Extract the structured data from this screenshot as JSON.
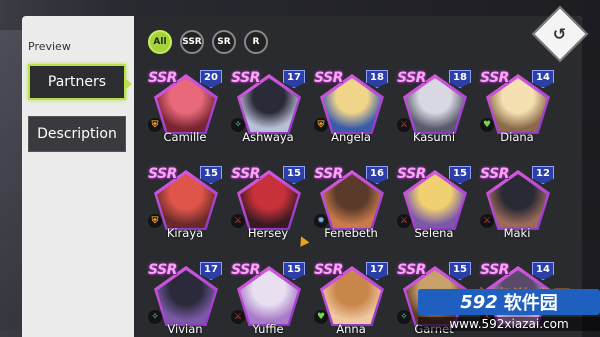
{
  "sidebar": {
    "preview_label": "Preview",
    "items": [
      {
        "label": "Partners",
        "active": true
      },
      {
        "label": "Description",
        "active": false
      }
    ]
  },
  "filters": [
    {
      "label": "All",
      "active": true
    },
    {
      "label": "SSR",
      "active": false
    },
    {
      "label": "SR",
      "active": false
    },
    {
      "label": "R",
      "active": false
    }
  ],
  "back_icon": "return-arrow-icon",
  "partners": [
    {
      "name": "Camille",
      "rarity": "SSR",
      "level": "20",
      "role": "shield",
      "role_color": "#e8a02a",
      "portrait": [
        "#e86a7a",
        "#7a2432"
      ]
    },
    {
      "name": "Ashwaya",
      "rarity": "SSR",
      "level": "17",
      "role": "wings",
      "role_color": "#7fd6a6",
      "portrait": [
        "#2a2a38",
        "#b9bfd6"
      ]
    },
    {
      "name": "Angela",
      "rarity": "SSR",
      "level": "18",
      "role": "shield",
      "role_color": "#e8a02a",
      "portrait": [
        "#f0d48a",
        "#3a5ca8"
      ]
    },
    {
      "name": "Kasumi",
      "rarity": "SSR",
      "level": "18",
      "role": "blade",
      "role_color": "#d63b3b",
      "portrait": [
        "#d8d8e2",
        "#5a5a6e"
      ]
    },
    {
      "name": "Diana",
      "rarity": "SSR",
      "level": "14",
      "role": "heart",
      "role_color": "#6fd84a",
      "portrait": [
        "#f4e0b0",
        "#8a6a4a"
      ]
    },
    {
      "name": "Kiraya",
      "rarity": "SSR",
      "level": "15",
      "role": "shield",
      "role_color": "#e8a02a",
      "portrait": [
        "#e0554a",
        "#6a2a2a"
      ]
    },
    {
      "name": "Hersey",
      "rarity": "SSR",
      "level": "15",
      "role": "blade",
      "role_color": "#d63b3b",
      "portrait": [
        "#c8303a",
        "#3a1a22"
      ]
    },
    {
      "name": "Fenebeth",
      "rarity": "SSR",
      "level": "16",
      "role": "gear",
      "role_color": "#6ab4e8",
      "portrait": [
        "#5a3a2a",
        "#c87a4a"
      ]
    },
    {
      "name": "Selena",
      "rarity": "SSR",
      "level": "15",
      "role": "blade",
      "role_color": "#d63b3b",
      "portrait": [
        "#f0d070",
        "#7a5aa8"
      ]
    },
    {
      "name": "Maki",
      "rarity": "SSR",
      "level": "12",
      "role": "blade",
      "role_color": "#d63b3b",
      "portrait": [
        "#2a2a34",
        "#9a6a5a"
      ]
    },
    {
      "name": "Vivian",
      "rarity": "SSR",
      "level": "17",
      "role": "wings",
      "role_color": "#7fd6a6",
      "portrait": [
        "#2a2a3a",
        "#7a5aa8"
      ]
    },
    {
      "name": "Yuffie",
      "rarity": "SSR",
      "level": "15",
      "role": "blade",
      "role_color": "#d63b3b",
      "portrait": [
        "#e8e0f0",
        "#a87ac8"
      ]
    },
    {
      "name": "Anna",
      "rarity": "SSR",
      "level": "17",
      "role": "heart",
      "role_color": "#6fd84a",
      "portrait": [
        "#c8864a",
        "#f0c8a0"
      ]
    },
    {
      "name": "Garnet",
      "rarity": "SSR",
      "level": "15",
      "role": "wings",
      "role_color": "#7fd6a6",
      "portrait": [
        "#c8a06a",
        "#5a3a2a"
      ]
    },
    {
      "name": "",
      "rarity": "SSR",
      "level": "14",
      "role": "blade",
      "role_color": "#d63b3b",
      "portrait": [
        "#5a4a6a",
        "#c8a0d0"
      ]
    }
  ],
  "watermark": {
    "cn_text": "安卓游戏网",
    "logo_num": "592",
    "logo_cn": "软件园",
    "url": "www.592xiazai.com"
  }
}
